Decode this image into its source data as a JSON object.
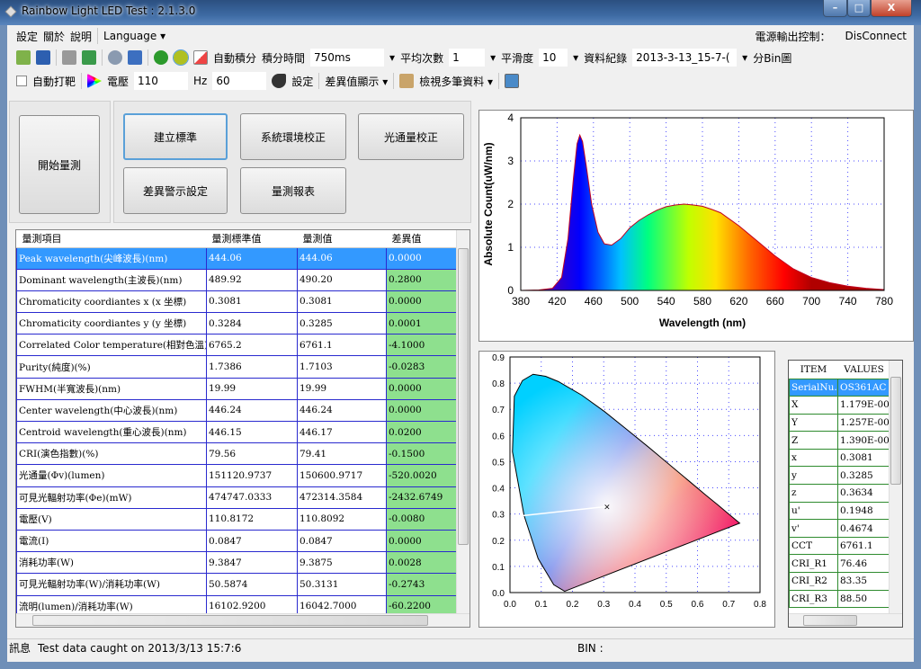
{
  "window": {
    "title": "Rainbow Light LED Test : 2.1.3.0",
    "min": "–",
    "max": "□",
    "close": "X"
  },
  "menu": {
    "items": [
      "設定",
      "關於",
      "說明"
    ],
    "language": "Language ▾",
    "power_label": "電源輸出控制：",
    "power_value": "DisConnect"
  },
  "toolbar1": {
    "auto_integrate": "自動積分",
    "integration_time_label": "積分時間",
    "integration_time": "750ms",
    "avg_label": "平均次數",
    "avg": "1",
    "smooth_label": "平滑度",
    "smooth": "10",
    "record_label": "資料紀錄",
    "record": "2013-3-13_15-7-(",
    "bin_label": "分Bin圖"
  },
  "toolbar2": {
    "auto_target": "自動打靶",
    "voltage_label": "電壓",
    "voltage": "110",
    "hz_label": "Hz",
    "hz": "60",
    "settings": "設定",
    "diff_display": "差異值顯示 ▾",
    "view_multi": "檢視多筆資料 ▾"
  },
  "buttons": {
    "start": "開始量測",
    "build_standard": "建立標準",
    "sys_calib": "系統環境校正",
    "flux_calib": "光通量校正",
    "diff_alarm": "差異警示設定",
    "report": "量測報表"
  },
  "table": {
    "headers": [
      "量測項目",
      "量測標準值",
      "量測值",
      "差異值"
    ],
    "rows": [
      [
        "Peak wavelength(尖峰波長)(nm)",
        "444.06",
        "444.06",
        "0.0000"
      ],
      [
        "Dominant wavelength(主波長)(nm)",
        "489.92",
        "490.20",
        "0.2800"
      ],
      [
        "Chromaticity coordiantes x (x 坐標)",
        "0.3081",
        "0.3081",
        "0.0000"
      ],
      [
        "Chromaticity coordiantes y (y 坐標)",
        "0.3284",
        "0.3285",
        "0.0001"
      ],
      [
        "Correlated Color temperature(相對色溫)",
        "6765.2",
        "6761.1",
        "-4.1000"
      ],
      [
        "Purity(純度)(%)",
        "1.7386",
        "1.7103",
        "-0.0283"
      ],
      [
        "FWHM(半寬波長)(nm)",
        "19.99",
        "19.99",
        "0.0000"
      ],
      [
        "Center wavelength(中心波長)(nm)",
        "446.24",
        "446.24",
        "0.0000"
      ],
      [
        "Centroid wavelength(重心波長)(nm)",
        "446.15",
        "446.17",
        "0.0200"
      ],
      [
        "CRI(演色指數)(%)",
        "79.56",
        "79.41",
        "-0.1500"
      ],
      [
        "光通量(Φv)(lumen)",
        "151120.9737",
        "150600.9717",
        "-520.0020"
      ],
      [
        "可見光輻射功率(Φe)(mW)",
        "474747.0333",
        "472314.3584",
        "-2432.6749"
      ],
      [
        "電壓(V)",
        "110.8172",
        "110.8092",
        "-0.0080"
      ],
      [
        "電流(I)",
        "0.0847",
        "0.0847",
        "0.0000"
      ],
      [
        "消耗功率(W)",
        "9.3847",
        "9.3875",
        "0.0028"
      ],
      [
        "可見光輻射功率(W)/消耗功率(W)",
        "50.5874",
        "50.3131",
        "-0.2743"
      ],
      [
        "流明(lumen)/消耗功率(W)",
        "16102.9200",
        "16042.7000",
        "-60.2200"
      ]
    ]
  },
  "items": {
    "headers": [
      "ITEM",
      "VALUES"
    ],
    "rows": [
      [
        "SerialNu...",
        "OS361AC"
      ],
      [
        "X",
        "1.179E-00"
      ],
      [
        "Y",
        "1.257E-00"
      ],
      [
        "Z",
        "1.390E-00"
      ],
      [
        "x",
        "0.3081"
      ],
      [
        "y",
        "0.3285"
      ],
      [
        "z",
        "0.3634"
      ],
      [
        "u'",
        "0.1948"
      ],
      [
        "v'",
        "0.4674"
      ],
      [
        "CCT",
        "6761.1"
      ],
      [
        "CRI_R1",
        "76.46"
      ],
      [
        "CRI_R2",
        "83.35"
      ],
      [
        "CRI_R3",
        "88.50"
      ]
    ]
  },
  "status": {
    "label": "訊息",
    "message": "Test data caught on 2013/3/13 15:7:6",
    "bin": "BIN :"
  },
  "chart_data": [
    {
      "type": "area",
      "xlabel": "Wavelength (nm)",
      "ylabel": "Absolute Count(uW/nm)",
      "xlim": [
        380,
        780
      ],
      "ylim": [
        0,
        4
      ],
      "xticks": [
        380,
        420,
        460,
        500,
        540,
        580,
        620,
        660,
        700,
        740,
        780
      ],
      "yticks": [
        0,
        1,
        2,
        3,
        4
      ],
      "grid": true,
      "x": [
        380,
        400,
        415,
        425,
        432,
        438,
        442,
        445,
        448,
        452,
        458,
        465,
        472,
        480,
        490,
        500,
        510,
        520,
        530,
        540,
        550,
        560,
        570,
        580,
        590,
        600,
        620,
        640,
        660,
        680,
        700,
        720,
        740,
        760,
        780
      ],
      "y": [
        0,
        0.01,
        0.05,
        0.3,
        1.2,
        2.6,
        3.4,
        3.6,
        3.45,
        2.9,
        2.0,
        1.35,
        1.08,
        1.05,
        1.2,
        1.45,
        1.62,
        1.75,
        1.86,
        1.94,
        1.98,
        2.0,
        1.98,
        1.95,
        1.88,
        1.8,
        1.5,
        1.15,
        0.8,
        0.5,
        0.3,
        0.18,
        0.1,
        0.05,
        0.02
      ]
    },
    {
      "type": "scatter",
      "xlim": [
        0,
        0.8
      ],
      "ylim": [
        0,
        0.9
      ],
      "xticks": [
        0.0,
        0.1,
        0.2,
        0.3,
        0.4,
        0.5,
        0.6,
        0.7,
        0.8
      ],
      "yticks": [
        0.0,
        0.1,
        0.2,
        0.3,
        0.4,
        0.5,
        0.6,
        0.7,
        0.8,
        0.9
      ],
      "grid": true,
      "points": [
        {
          "x": 0.3081,
          "y": 0.3285
        }
      ]
    }
  ]
}
